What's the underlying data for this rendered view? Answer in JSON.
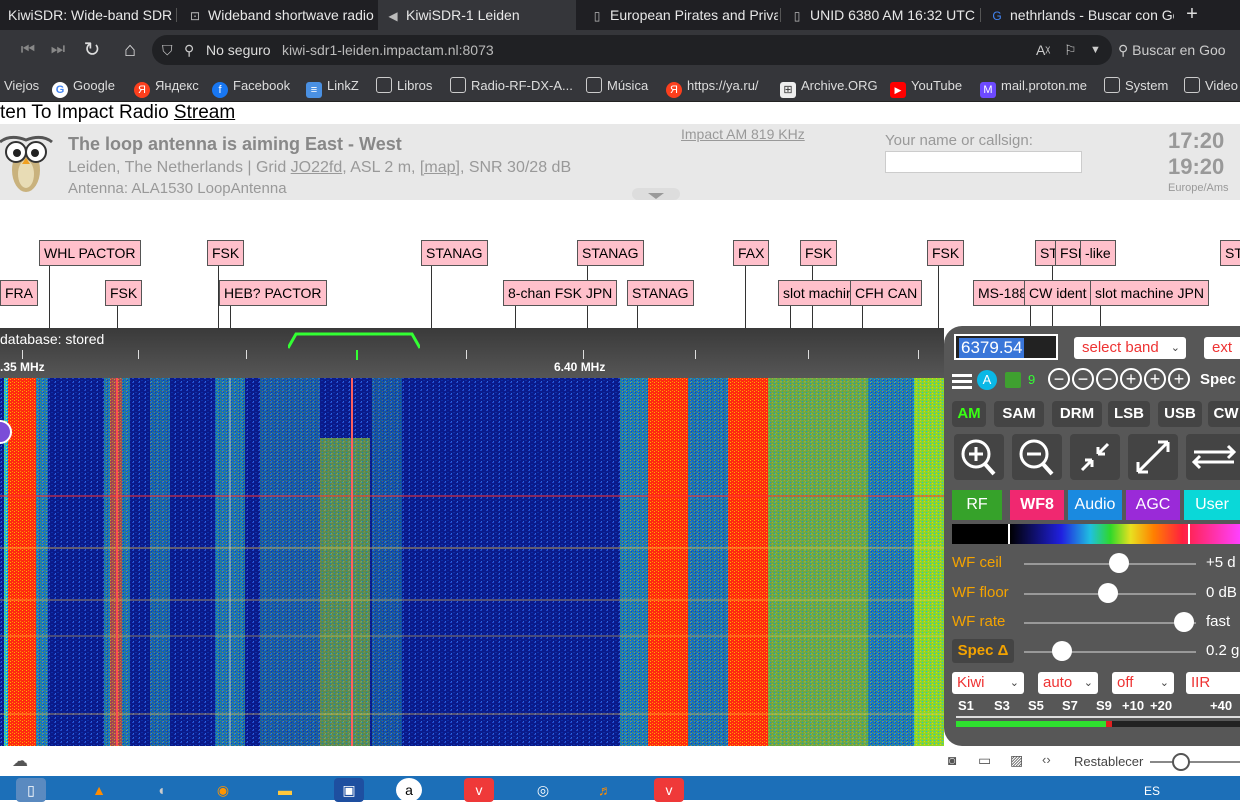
{
  "browser": {
    "tabs": [
      {
        "label": "KiwiSDR: Wide-band SDR",
        "icon": "kiwi-icon"
      },
      {
        "label": "Wideband shortwave radio",
        "icon": "radio-icon"
      },
      {
        "label": "KiwiSDR-1 Leiden",
        "icon": "speaker-icon"
      },
      {
        "label": "European Pirates and Priva",
        "icon": "page-icon"
      },
      {
        "label": "UNID 6380 AM 16:32 UTC",
        "icon": "page-icon"
      },
      {
        "label": "nethrlands - Buscar con Go",
        "icon": "google-icon"
      }
    ],
    "new_tab": "+",
    "security_label": "No seguro",
    "url": "kiwi-sdr1-leiden.impactam.nl:8073",
    "search_placeholder": "Buscar en Goo",
    "bookmarks": [
      {
        "label": "Viejos",
        "icon": "folder-icon"
      },
      {
        "label": "Google",
        "icon": "google-icon"
      },
      {
        "label": "Яндекс",
        "icon": "yandex-icon"
      },
      {
        "label": "Facebook",
        "icon": "facebook-icon"
      },
      {
        "label": "LinkZ",
        "icon": "doc-icon"
      },
      {
        "label": "Libros",
        "icon": "folder-icon"
      },
      {
        "label": "Radio-RF-DX-A...",
        "icon": "folder-icon"
      },
      {
        "label": "Música",
        "icon": "folder-icon"
      },
      {
        "label": "https://ya.ru/",
        "icon": "yandex-icon"
      },
      {
        "label": "Archive.ORG",
        "icon": "archive-icon"
      },
      {
        "label": "YouTube",
        "icon": "youtube-icon"
      },
      {
        "label": "mail.proton.me",
        "icon": "proton-icon"
      },
      {
        "label": "System",
        "icon": "folder-icon"
      },
      {
        "label": "Video",
        "icon": "folder-icon"
      }
    ]
  },
  "page": {
    "listen_prefix": "ten To Impact Radio ",
    "listen_link": "Stream",
    "header": {
      "title": "The loop antenna is aiming East - West",
      "loc_prefix": "Leiden, The Netherlands | Grid ",
      "grid": "JO22fd",
      "loc_mid": ", ASL 2 m, ",
      "map": "[map]",
      "loc_suffix": ", SNR 30/28 dB",
      "antenna": "Antenna: ALA1530 LoopAntenna",
      "station_link": "Impact AM 819 KHz",
      "name_label": "Your name or callsign:",
      "time_utc": "17:20",
      "time_local": "19:20",
      "timezone": "Europe/Ams"
    },
    "labels_row1": [
      "WHL PACTOR",
      "FSK",
      "STANAG",
      "STANAG",
      "FAX",
      "FSK",
      "FSK",
      "ST",
      "FSK",
      "-like",
      "ST"
    ],
    "labels_row2": [
      "FRA",
      "FSK",
      "HEB? PACTOR",
      "8-chan FSK JPN",
      "STANAG",
      "slot machin",
      "CFH CAN",
      "MS-188",
      "CW ident",
      "slot machine JPN"
    ],
    "scale": {
      "db_status": "database: stored",
      "mhz_left": ".35 MHz",
      "mhz_mid": "6.40 MHz"
    },
    "statusbar": {
      "zoom_label": "Restablecer"
    }
  },
  "panel": {
    "frequency": "6379.54",
    "select_band": "select band",
    "ext": "ext",
    "auto_badge": "A",
    "nine": "9",
    "spec": "Spec",
    "modes": [
      "AM",
      "SAM",
      "DRM",
      "LSB",
      "USB",
      "CW"
    ],
    "tabs": [
      "RF",
      "WF8",
      "Audio",
      "AGC",
      "User"
    ],
    "sliders": [
      {
        "label": "WF ceil",
        "value": "+5 d",
        "level": 0.55
      },
      {
        "label": "WF floor",
        "value": "0 dB",
        "level": 0.49
      },
      {
        "label": "WF rate",
        "value": "fast",
        "level": 0.93
      },
      {
        "label": "Spec Δ",
        "value": "0.2 g",
        "level": 0.22
      }
    ],
    "selects": [
      "Kiwi",
      "auto",
      "off",
      "IIR"
    ],
    "smeter": [
      "S1",
      "S3",
      "S5",
      "S7",
      "S9",
      "+10",
      "+20",
      "+40"
    ]
  },
  "taskbar": {
    "language": "ES"
  },
  "colors": {
    "accent": "#3a76d9",
    "label_bg": "#ffc0cb",
    "am_green": "#39ff14",
    "mode_orange": "#f4a300"
  }
}
